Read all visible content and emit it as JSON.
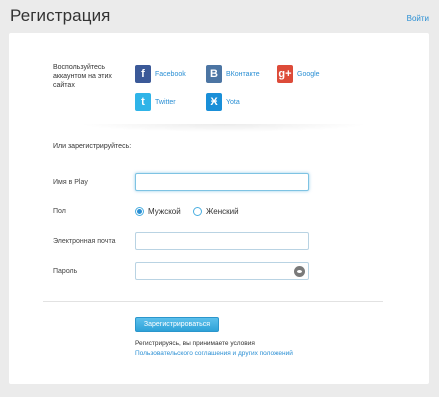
{
  "header": {
    "title": "Регистрация",
    "login_link": "Войти"
  },
  "social": {
    "label": "Воспользуйтесь аккаунтом на этих сайтах",
    "providers": [
      {
        "name": "Facebook",
        "icon": "facebook-icon",
        "glyph": "f",
        "color": "#3b5998"
      },
      {
        "name": "ВКонтакте",
        "icon": "vkontakte-icon",
        "glyph": "В",
        "color": "#4c75a3"
      },
      {
        "name": "Google",
        "icon": "google-plus-icon",
        "glyph": "g+",
        "color": "#dd4b39"
      },
      {
        "name": "Twitter",
        "icon": "twitter-icon",
        "glyph": "t",
        "color": "#2fb4e8"
      },
      {
        "name": "Yota",
        "icon": "yota-icon",
        "glyph": "Ӿ",
        "color": "#1a8fd8"
      }
    ]
  },
  "form": {
    "or_label": "Или зарегистрируйтесь:",
    "name_label": "Имя в Play",
    "name_value": "",
    "gender_label": "Пол",
    "gender_options": [
      "Мужской",
      "Женский"
    ],
    "gender_selected": "Мужской",
    "email_label": "Электронная почта",
    "email_value": "",
    "password_label": "Пароль",
    "password_value": "",
    "submit_label": "Зарегистрироваться",
    "terms_text": "Регистрируясь, вы принимаете условия ",
    "terms_link": "Пользовательского соглашения и других положений"
  },
  "colors": {
    "accent": "#2a8fd4",
    "button": "#3eb0e2"
  }
}
